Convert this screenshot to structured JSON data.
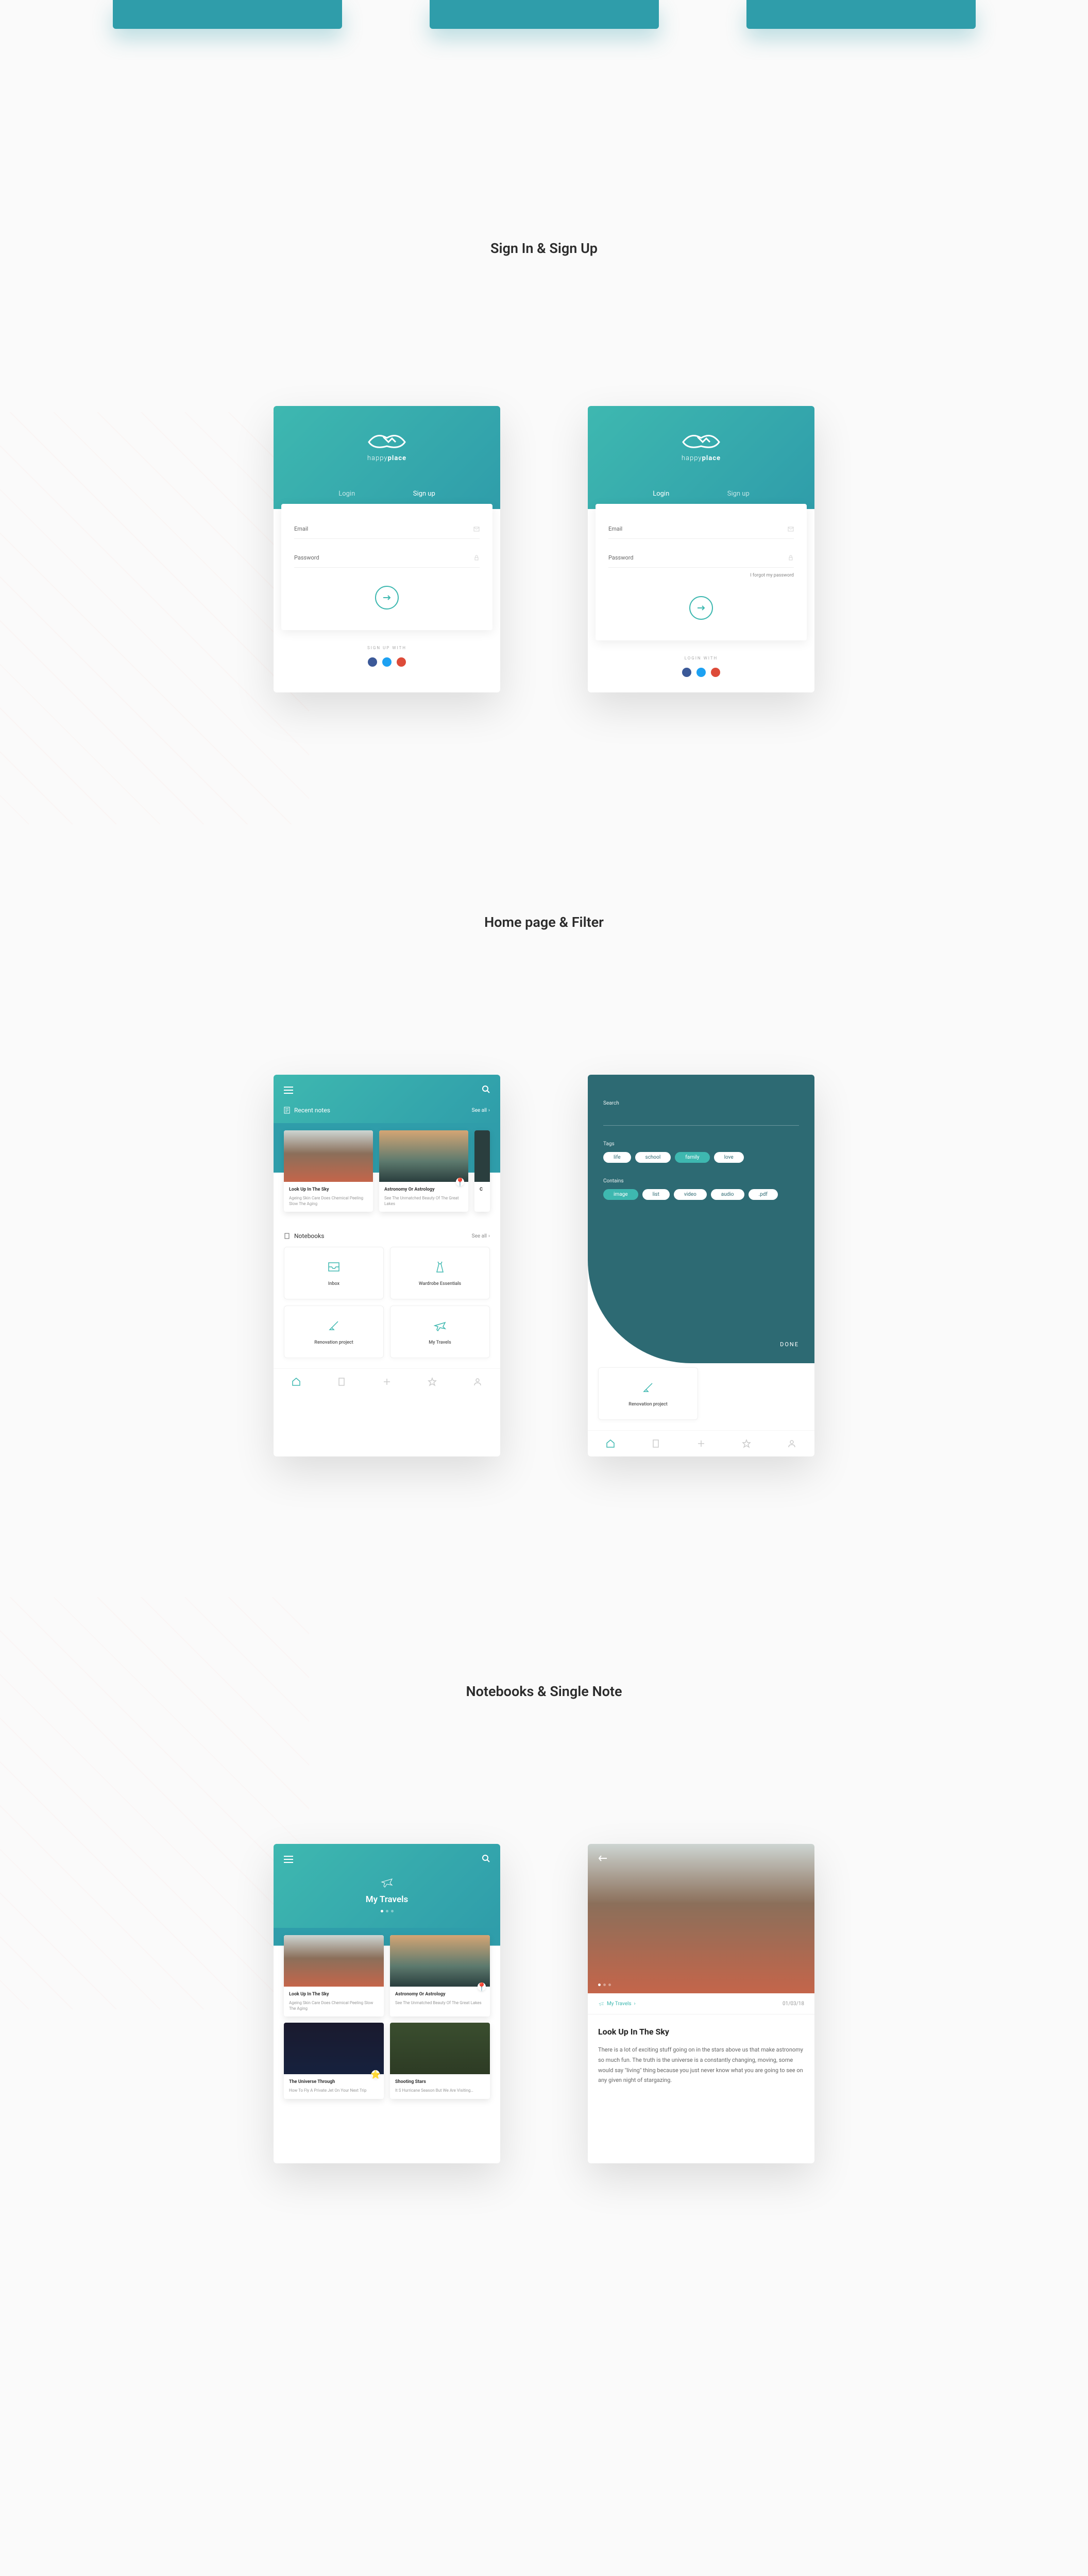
{
  "sections": {
    "signin": "Sign In & Sign Up",
    "home": "Home page & Filter",
    "notebooks": "Notebooks & Single Note"
  },
  "logo": {
    "prefix": "happy",
    "suffix": "place"
  },
  "auth": {
    "login_tab": "Login",
    "signup_tab": "Sign up",
    "email_label": "Email",
    "password_label": "Password",
    "forgot": "I forgot my password",
    "signup_with": "SIGN UP WITH",
    "login_with": "LOGIN WITH"
  },
  "home": {
    "recent_notes": "Recent notes",
    "see_all": "See all",
    "notes": [
      {
        "title": "Look Up In The Sky",
        "desc": "Ageing Skin Care Does Chemical Peeling Slow The Aging"
      },
      {
        "title": "Astronomy Or Astrology",
        "desc": "See The Unmatched Beauty Of The Great Lakes"
      }
    ],
    "notebooks_title": "Notebooks",
    "notebooks": [
      {
        "label": "Inbox"
      },
      {
        "label": "Wardrobe Essentials"
      },
      {
        "label": "Renovation project"
      },
      {
        "label": "My Travels"
      }
    ]
  },
  "filter": {
    "search_label": "Search",
    "tags_label": "Tags",
    "tags": [
      {
        "label": "life",
        "active": false
      },
      {
        "label": "school",
        "active": false
      },
      {
        "label": "family",
        "active": true
      },
      {
        "label": "love",
        "active": false
      }
    ],
    "contains_label": "Contains",
    "contains": [
      {
        "label": "image",
        "active": true
      },
      {
        "label": "list",
        "active": false
      },
      {
        "label": "video",
        "active": false
      },
      {
        "label": "audio",
        "active": false
      },
      {
        "label": ".pdf",
        "active": false
      }
    ],
    "done": "DONE",
    "peek_notebook": "Renovation project"
  },
  "notebook_detail": {
    "title": "My Travels",
    "notes": [
      {
        "title": "Look Up In The Sky",
        "desc": "Ageing Skin Care Does Chemical Peeling Slow The Aging"
      },
      {
        "title": "Astronomy Or Astrology",
        "desc": "See The Unmatched Beauty Of The Great Lakes"
      },
      {
        "title": "The Universe Through",
        "desc": "How To Fly A Private Jet On Your Next Trip"
      },
      {
        "title": "Shooting Stars",
        "desc": "It S Hurricane Season But We Are Visiting…"
      }
    ]
  },
  "single_note": {
    "crumb": "My Travels",
    "date": "01/03/18",
    "title": "Look Up In The Sky",
    "body": "There is a lot of exciting stuff going on in the stars above us that make astronomy so much fun. The truth is the universe is a constantly changing, moving, some would say \"living\" thing because you just never know what you are going to see on any given night of stargazing."
  }
}
